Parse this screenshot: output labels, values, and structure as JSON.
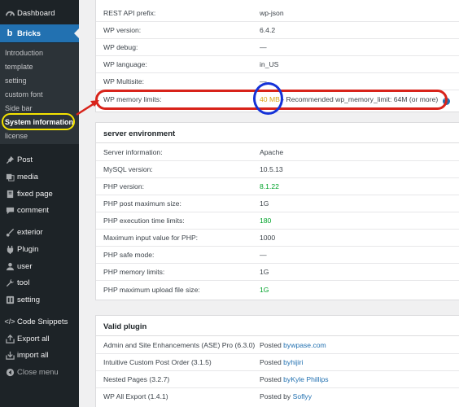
{
  "sidebar": {
    "top_items": [
      {
        "label": "Dashboard",
        "icon": "gauge-icon"
      },
      {
        "label": "Bricks",
        "icon": "bricks-logo-icon"
      }
    ],
    "submenu": [
      "Introduction",
      "template",
      "setting",
      "custom font",
      "Side bar",
      "System information",
      "license"
    ],
    "items": [
      {
        "label": "Post",
        "icon": "pin-icon"
      },
      {
        "label": "media",
        "icon": "media-icon"
      },
      {
        "label": "fixed page",
        "icon": "page-icon"
      },
      {
        "label": "comment",
        "icon": "comment-icon"
      },
      {
        "label": "exterior",
        "icon": "brush-icon"
      },
      {
        "label": "Plugin",
        "icon": "plugin-icon"
      },
      {
        "label": "user",
        "icon": "user-icon"
      },
      {
        "label": "tool",
        "icon": "wrench-icon"
      },
      {
        "label": "setting",
        "icon": "settings-icon"
      },
      {
        "label": "Code Snippets",
        "icon": "code-icon"
      },
      {
        "label": "Export all",
        "icon": "export-icon"
      },
      {
        "label": "import all",
        "icon": "import-icon"
      },
      {
        "label": "Close menu",
        "icon": "collapse-icon"
      }
    ]
  },
  "wp_env": {
    "rows": [
      {
        "k": "REST API prefix:",
        "v": "wp-json"
      },
      {
        "k": "WP version:",
        "v": "6.4.2"
      },
      {
        "k": "WP debug:",
        "v": "—"
      },
      {
        "k": "WP language:",
        "v": "in_US"
      },
      {
        "k": "WP Multisite:",
        "v": "—"
      }
    ],
    "memory": {
      "k": "WP memory limits:",
      "v": "40 MB",
      "note": "- Recommended wp_memory_limit: 64M (or more)",
      "help": "?"
    }
  },
  "server_env": {
    "title": "server environment",
    "rows": [
      {
        "k": "Server information:",
        "v": "Apache"
      },
      {
        "k": "MySQL version:",
        "v": "10.5.13"
      },
      {
        "k": "PHP version:",
        "v": "8.1.22"
      },
      {
        "k": "PHP post maximum size:",
        "v": "1G"
      },
      {
        "k": "PHP execution time limits:",
        "v": "180"
      },
      {
        "k": "Maximum input value for PHP:",
        "v": "1000"
      },
      {
        "k": "PHP safe mode:",
        "v": "—"
      },
      {
        "k": "PHP memory limits:",
        "v": "1G"
      },
      {
        "k": "PHP maximum upload file size:",
        "v": "1G"
      }
    ]
  },
  "plugins": {
    "title": "Valid plugin",
    "posted": "Posted",
    "rows": [
      {
        "k": "Admin and Site Enhancements (ASE) Pro (6.3.0)",
        "by": "bywpase.com"
      },
      {
        "k": "Intuitive Custom Post Order (3.1.5)",
        "by": "byhijiri"
      },
      {
        "k": "Nested Pages (3.2.7)",
        "by": "byKyle Phillips"
      },
      {
        "k": "WP All Export (1.4.1)",
        "by": "Soflyy",
        "pre": "by "
      }
    ]
  },
  "colors": {
    "sidebar_bg": "#1d2327",
    "accent": "#2271b1",
    "ok_green": "#00a32a",
    "warn_orange": "#dba617",
    "annotation_red": "#d8231a",
    "annotation_blue": "#1532d8",
    "annotation_yellow": "#f5e400"
  }
}
